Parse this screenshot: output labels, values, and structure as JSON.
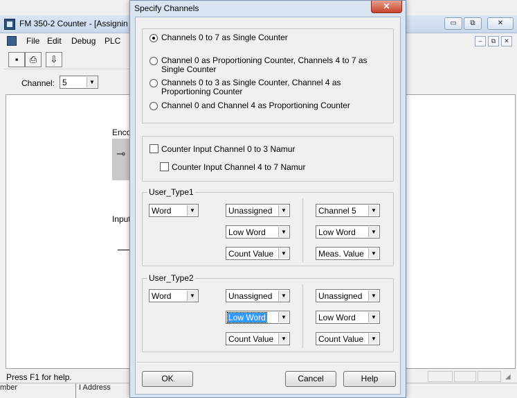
{
  "app": {
    "title": "FM 350-2 Counter - [Assignin",
    "menu": [
      "File",
      "Edit",
      "Debug",
      "PLC"
    ],
    "window_controls": [
      "▭",
      "⧉",
      "✕"
    ],
    "mdi_controls": [
      "–",
      "⧉",
      "✕"
    ],
    "channel_label": "Channel:",
    "channel_value": "5",
    "canvas": {
      "encoder_label": "Enco",
      "input_label": "Input"
    },
    "status_text": "Press F1 for help.",
    "bottom_labels": [
      "mber",
      "I Address"
    ]
  },
  "dialog": {
    "title": "Specify Channels",
    "close_label": "✕",
    "radios": [
      {
        "label": "Channels 0 to 7 as Single Counter",
        "checked": true
      },
      {
        "label": "Channel 0 as Proportioning Counter, Channels 4 to 7 as Single Counter",
        "checked": false
      },
      {
        "label": "Channels 0 to 3 as Single Counter, Channel 4 as Proportioning Counter",
        "checked": false
      },
      {
        "label": "Channel 0 and Channel 4 as Proportioning Counter",
        "checked": false
      }
    ],
    "checkboxes": [
      {
        "label": "Counter Input Channel 0 to 3 Namur",
        "checked": false
      },
      {
        "label": "Counter Input Channel 4 to 7 Namur",
        "checked": false
      }
    ],
    "user_type1": {
      "legend": "User_Type1",
      "type": "Word",
      "col2": [
        "Unassigned",
        "Low Word",
        "Count Value"
      ],
      "col3": [
        "Channel 5",
        "Low Word",
        "Meas. Value"
      ]
    },
    "user_type2": {
      "legend": "User_Type2",
      "type": "Word",
      "col2": [
        "Unassigned",
        "Low Word",
        "Count Value"
      ],
      "col3": [
        "Unassigned",
        "Low Word",
        "Count Value"
      ]
    },
    "buttons": {
      "ok": "OK",
      "cancel": "Cancel",
      "help": "Help"
    }
  }
}
